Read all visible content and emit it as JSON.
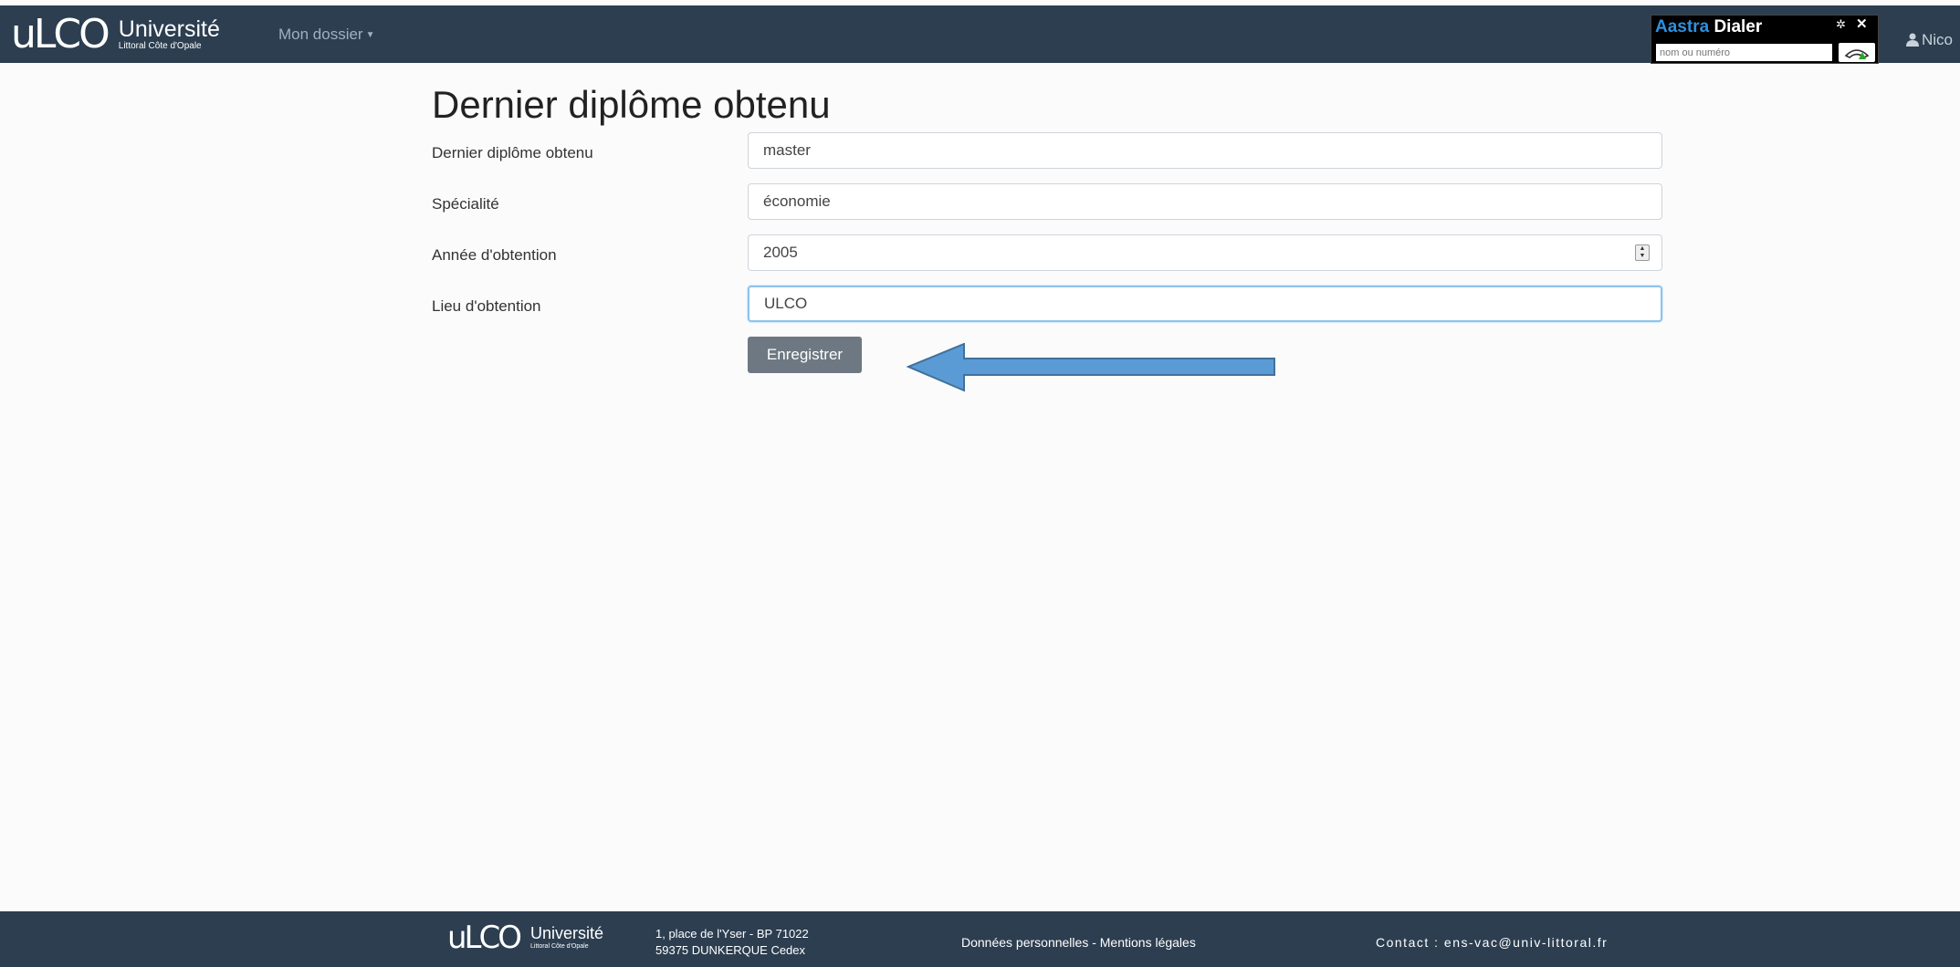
{
  "header": {
    "logo_mark": "uLCO",
    "logo_title": "Université",
    "logo_subtitle": "Littoral Côte d'Opale",
    "nav_dossier": "Mon dossier",
    "dialer": {
      "brand_a": "Aastra",
      "brand_b": "Dialer",
      "placeholder": "nom ou numéro"
    },
    "user_name": "Nico"
  },
  "main": {
    "title": "Dernier diplôme obtenu",
    "fields": [
      {
        "label": "Dernier diplôme obtenu",
        "value": "master"
      },
      {
        "label": "Spécialité",
        "value": "économie"
      },
      {
        "label": "Année d'obtention",
        "value": "2005"
      },
      {
        "label": "Lieu d'obtention",
        "value": "ULCO"
      }
    ],
    "save_label": "Enregistrer",
    "arrow_color": "#5b9bd5"
  },
  "footer": {
    "logo_mark": "uLCO",
    "logo_title": "Université",
    "logo_subtitle": "Littoral Côte d'Opale",
    "address_line1": "1, place de l'Yser - BP 71022",
    "address_line2": "59375 DUNKERQUE Cedex",
    "legal": "Données personnelles - Mentions légales",
    "contact": "Contact : ens-vac@univ-littoral.fr"
  },
  "colors": {
    "navbar": "#2c3e50",
    "button": "#6d7882",
    "focus_border": "#8ec3ec"
  }
}
